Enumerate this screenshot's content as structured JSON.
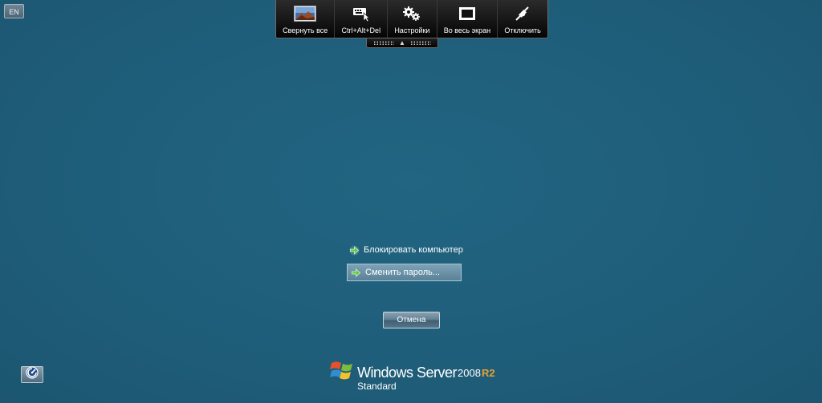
{
  "language_indicator": "EN",
  "toolbar": {
    "buttons": [
      {
        "label": "Свернуть все",
        "icon": "landscape-icon"
      },
      {
        "label": "Ctrl+Alt+Del",
        "icon": "keyboard-icon"
      },
      {
        "label": "Настройки",
        "icon": "gears-icon"
      },
      {
        "label": "Во весь экран",
        "icon": "fullscreen-icon"
      },
      {
        "label": "Отключить",
        "icon": "disconnect-icon"
      }
    ]
  },
  "options": {
    "lock": "Блокировать компьютер",
    "change_password": "Сменить пароль..."
  },
  "cancel_label": "Отмена",
  "branding": {
    "product": "Windows Server",
    "version": "2008",
    "release": "R2",
    "edition": "Standard"
  },
  "colors": {
    "background": "#1f5d79",
    "toolbar": "#0a0a0a",
    "accent_green": "#5ecf3c",
    "release_orange": "#e7a035"
  }
}
